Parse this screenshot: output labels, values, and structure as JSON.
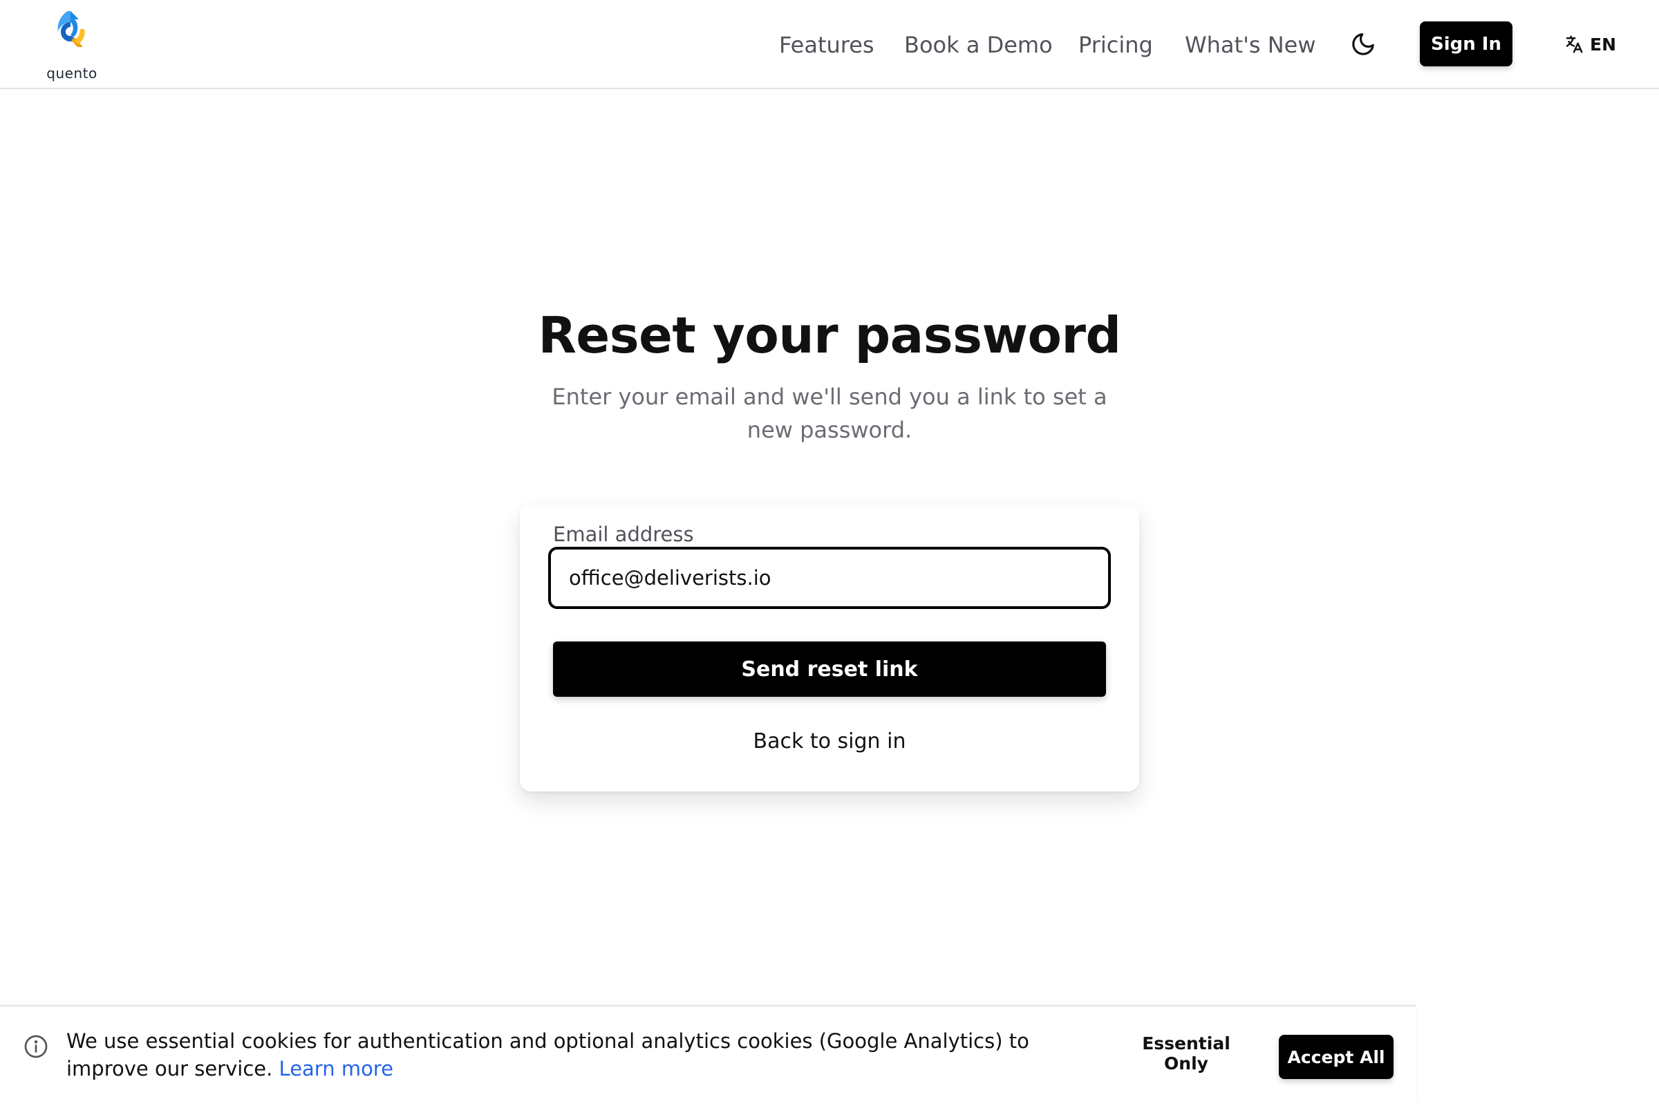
{
  "brand": {
    "name": "quento",
    "logo_icon": "quento-logo-icon"
  },
  "nav": {
    "items": [
      {
        "label": "Features"
      },
      {
        "label": "Book a Demo"
      },
      {
        "label": "Pricing"
      },
      {
        "label": "What's New"
      }
    ],
    "theme_icon": "moon-icon",
    "sign_in_label": "Sign In",
    "language_icon": "translate-icon",
    "language_label": "EN"
  },
  "main": {
    "title": "Reset your password",
    "subtitle": "Enter your email and we'll send you a link to set a new password.",
    "email_label": "Email address",
    "email_value": "office@deliverists.io",
    "submit_label": "Send reset link",
    "back_link": "Back to sign in"
  },
  "cookie_banner": {
    "icon": "info-icon",
    "text": "We use essential cookies for authentication and optional analytics cookies (Google Analytics) to improve our service.",
    "learn_more": "Learn more",
    "essential_label": "Essential Only",
    "accept_label": "Accept All"
  },
  "colors": {
    "primary": "#000000",
    "link": "#2563eb",
    "logo_blue": "#1e88e5",
    "logo_orange": "#f59e0b"
  }
}
